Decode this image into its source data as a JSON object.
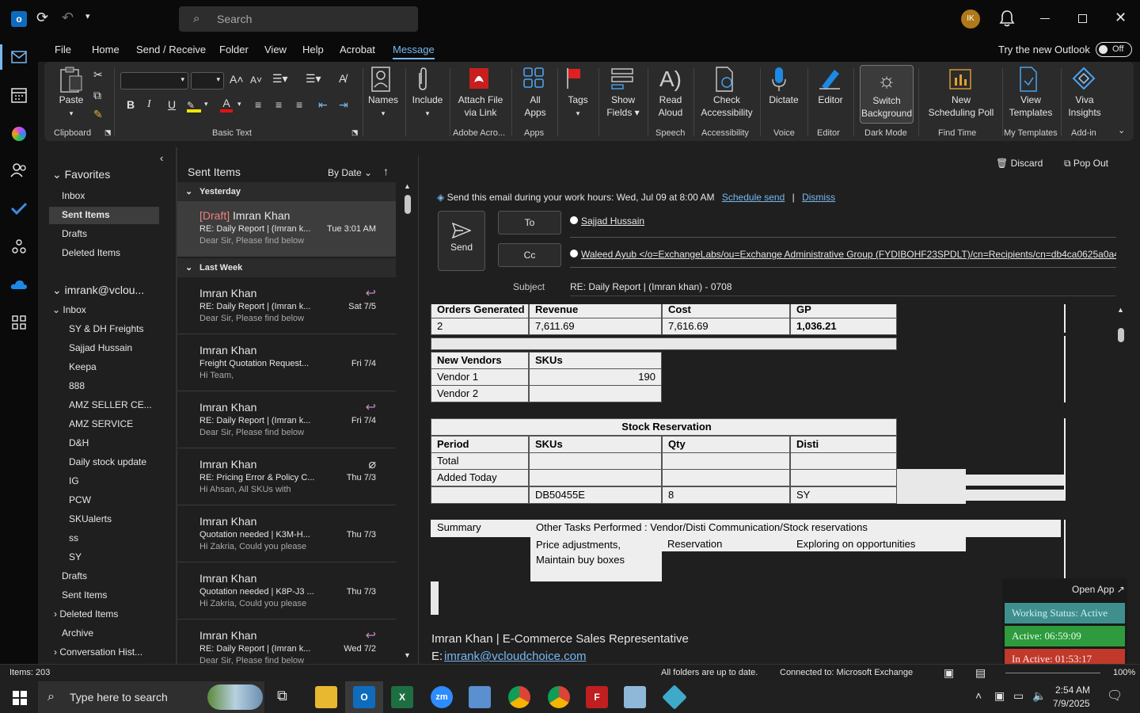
{
  "titlebar": {
    "search_placeholder": "Search",
    "avatar_initials": "IK"
  },
  "tabs": [
    "File",
    "Home",
    "Send / Receive",
    "Folder",
    "View",
    "Help",
    "Acrobat",
    "Message"
  ],
  "active_tab": "Message",
  "try_new_outlook": "Try the new Outlook",
  "toggle_state": "Off",
  "ribbon": {
    "paste": "Paste",
    "clipboard": "Clipboard",
    "basic_text": "Basic Text",
    "names": "Names",
    "include": "Include",
    "attach_file_line1": "Attach File",
    "attach_file_line2": "via Link",
    "adobe_acro": "Adobe Acro...",
    "all_apps_line1": "All",
    "all_apps_line2": "Apps",
    "apps": "Apps",
    "tags": "Tags",
    "show_fields_line1": "Show",
    "show_fields_line2": "Fields",
    "read_aloud_line1": "Read",
    "read_aloud_line2": "Aloud",
    "speech": "Speech",
    "check_acc_line1": "Check",
    "check_acc_line2": "Accessibility",
    "accessibility": "Accessibility",
    "dictate": "Dictate",
    "voice": "Voice",
    "editor": "Editor",
    "editor_group": "Editor",
    "switch_bg_line1": "Switch",
    "switch_bg_line2": "Background",
    "dark_mode": "Dark Mode",
    "new_poll_line1": "New",
    "new_poll_line2": "Scheduling Poll",
    "find_time": "Find Time",
    "view_templates_line1": "View",
    "view_templates_line2": "Templates",
    "my_templates": "My Templates",
    "viva_line1": "Viva",
    "viva_line2": "Insights",
    "add_in": "Add-in",
    "bold": "B",
    "italic": "I",
    "underline": "U"
  },
  "folders": {
    "favorites": "Favorites",
    "fav_items": [
      "Inbox",
      "Sent Items",
      "Drafts",
      "Deleted Items"
    ],
    "account": "imrank@vclou...",
    "inbox": "Inbox",
    "inbox_sub": [
      "SY & DH Freights",
      "Sajjad Hussain",
      "Keepa",
      "888",
      "AMZ SELLER CE...",
      "AMZ SERVICE",
      "D&H",
      "Daily stock update",
      "IG",
      "PCW",
      "SKUalerts",
      "ss",
      "SY"
    ],
    "drafts": "Drafts",
    "sent_items": "Sent Items",
    "deleted_items": "Deleted Items",
    "archive": "Archive",
    "conversation_history": "Conversation Hist..."
  },
  "msglist": {
    "title": "Sent Items",
    "sort": "By Date",
    "group_yesterday": "Yesterday",
    "group_last_week": "Last Week",
    "draft_tag": "[Draft]",
    "messages": [
      {
        "from": "Imran Khan",
        "subject": "RE: Daily Report | (Imran k...",
        "preview": "Dear Sir,  Please find below",
        "date": "Tue 3:01 AM"
      },
      {
        "from": "Imran Khan",
        "subject": "RE: Daily Report | (Imran k...",
        "preview": "Dear Sir,  Please find below",
        "date": "Sat 7/5"
      },
      {
        "from": "Imran Khan",
        "subject": "Freight Quotation Request...",
        "preview": "Hi Team,",
        "date": "Fri 7/4"
      },
      {
        "from": "Imran Khan",
        "subject": "RE: Daily Report | (Imran k...",
        "preview": "Dear Sir,  Please find below",
        "date": "Fri 7/4"
      },
      {
        "from": "Imran Khan",
        "subject": "RE: Pricing Error & Policy C...",
        "preview": "Hi Ahsan,  All SKUs with",
        "date": "Thu 7/3"
      },
      {
        "from": "Imran Khan",
        "subject": "Quotation needed | K3M-H...",
        "preview": "Hi Zakria,  Could you please",
        "date": "Thu 7/3"
      },
      {
        "from": "Imran Khan",
        "subject": "Quotation needed | K8P-J3 ...",
        "preview": "Hi Zakria,  Could you please",
        "date": "Thu 7/3"
      },
      {
        "from": "Imran Khan",
        "subject": "RE: Daily Report | (Imran k...",
        "preview": "Dear Sir,  Please find below",
        "date": "Wed 7/2"
      }
    ]
  },
  "compose": {
    "discard": "Discard",
    "pop_out": "Pop Out",
    "schedule_text": "Send this email during your work hours: Wed, Jul 09 at 8:00 AM",
    "schedule_send": "Schedule send",
    "sep": "|",
    "dismiss": "Dismiss",
    "send": "Send",
    "to_label": "To",
    "cc_label": "Cc",
    "to_value": "Sajjad Hussain",
    "cc_value": "Waleed Ayub </o=ExchangeLabs/ou=Exchange Administrative Group (FYDIBOHF23SPDLT)/cn=Recipients/cn=db4ca0625a0a40",
    "subject_label": "Subject",
    "subject_value": "RE:  Daily Report | (Imran khan) - 0708"
  },
  "body": {
    "t1_headers": [
      "Orders Generated",
      "Revenue",
      "Cost",
      "GP"
    ],
    "t1_values": [
      "2",
      "7,611.69",
      "7,616.69",
      "1,036.21"
    ],
    "t2_headers": [
      "New Vendors",
      "SKUs"
    ],
    "t2_rows": [
      [
        "Vendor 1",
        "190"
      ],
      [
        "Vendor 2",
        ""
      ]
    ],
    "stock_title": "Stock Reservation",
    "t3_headers": [
      "Period",
      "SKUs",
      "Qty",
      "Disti"
    ],
    "t3_rows": [
      [
        "Total",
        "",
        "",
        ""
      ],
      [
        "Added Today",
        "",
        "",
        ""
      ],
      [
        "",
        "DB50455E",
        "8",
        "SY"
      ]
    ],
    "summary_label": "Summary",
    "summary_line": "Other Tasks Performed :  Vendor/Disti Communication/Stock reservations",
    "summary_a": "Price adjustments, Maintain buy boxes",
    "summary_b": "Reservation",
    "summary_c": "Exploring on opportunities",
    "sig_name": "Imran Khan | E-Commerce Sales Representative",
    "sig_email_label": "E:",
    "sig_email": "imrank@vcloudchoice.com"
  },
  "widget": {
    "open_app": "Open App ↗",
    "working_status": "Working Status: Active",
    "active": "Active: 06:59:09",
    "inactive": "In Active: 01:53:17"
  },
  "statusbar": {
    "items": "Items: 203",
    "sync": "All folders are up to date.",
    "connected": "Connected to: Microsoft Exchange",
    "zoom": "100%"
  },
  "taskbar": {
    "search_placeholder": "Type here to search",
    "time": "2:54 AM",
    "date": "7/9/2025"
  },
  "colors": {
    "accent": "#78b8f0",
    "draft": "#f08080",
    "working": "#3f8f8f",
    "active": "#2e9b3e",
    "inactive": "#c0392b"
  }
}
